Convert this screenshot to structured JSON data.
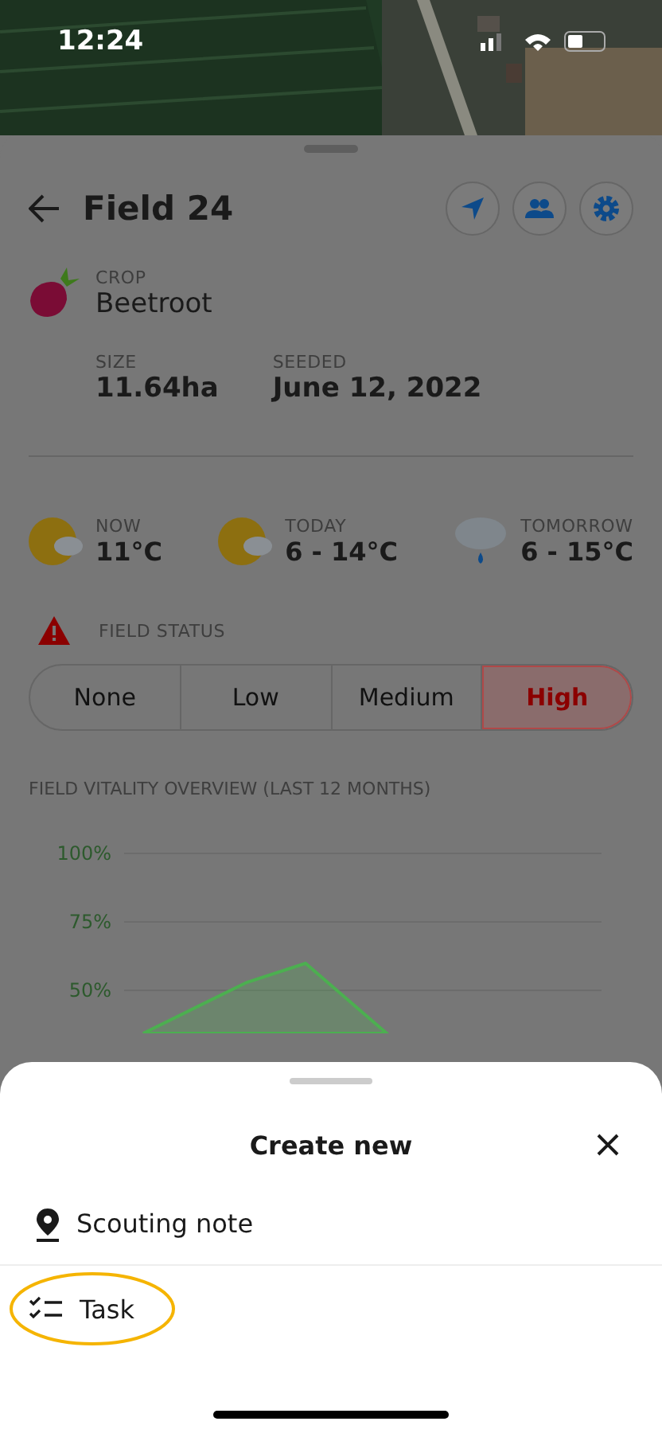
{
  "status_bar": {
    "time": "12:24"
  },
  "field": {
    "title": "Field 24",
    "crop_label": "CROP",
    "crop": "Beetroot",
    "stats": [
      {
        "label": "SIZE",
        "value": "11.64ha"
      },
      {
        "label": "SEEDED",
        "value": "June 12, 2022"
      }
    ]
  },
  "weather": [
    {
      "label": "NOW",
      "value": "11°C",
      "kind": "partly-cloudy"
    },
    {
      "label": "TODAY",
      "value": "6 - 14°C",
      "kind": "partly-cloudy"
    },
    {
      "label": "TOMORROW",
      "value": "6 - 15°C",
      "kind": "rain"
    }
  ],
  "field_status": {
    "label": "FIELD STATUS",
    "options": [
      {
        "label": "None",
        "selected": false
      },
      {
        "label": "Low",
        "selected": false
      },
      {
        "label": "Medium",
        "selected": false
      },
      {
        "label": "High",
        "selected": true
      }
    ]
  },
  "vitality": {
    "title": "FIELD VITALITY OVERVIEW (LAST 12 MONTHS)",
    "y_axis_labels": [
      "100%",
      "75%",
      "50%"
    ]
  },
  "sheet": {
    "title": "Create new",
    "items": [
      {
        "label": "Scouting note",
        "kind": "pin",
        "highlighted": false
      },
      {
        "label": "Task",
        "kind": "checklist",
        "highlighted": true
      }
    ]
  }
}
